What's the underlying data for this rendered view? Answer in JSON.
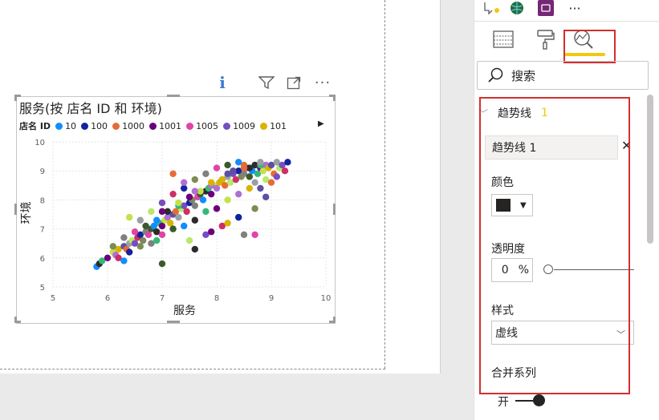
{
  "chart_data": {
    "type": "scatter",
    "title": "服务(按 店名 ID 和 环境)",
    "xlabel": "服务",
    "ylabel": "环境",
    "xlim": [
      5,
      10
    ],
    "ylim": [
      5,
      10
    ],
    "xticks": [
      "5",
      "6",
      "7",
      "8",
      "9",
      "10"
    ],
    "yticks": [
      "5",
      "6",
      "7",
      "8",
      "9",
      "10"
    ],
    "grid": true,
    "legend": {
      "title": "店名 ID",
      "placement": "top",
      "entries": [
        {
          "name": "10",
          "color": "#118dff"
        },
        {
          "name": "100",
          "color": "#12239e"
        },
        {
          "name": "1000",
          "color": "#e66c37"
        },
        {
          "name": "1001",
          "color": "#6b007b"
        },
        {
          "name": "1005",
          "color": "#e044a7"
        },
        {
          "name": "1009",
          "color": "#744ec2"
        },
        {
          "name": "101",
          "color": "#d9b300"
        }
      ]
    },
    "palette": [
      "#118dff",
      "#12239e",
      "#e66c37",
      "#6b007b",
      "#e044a7",
      "#744ec2",
      "#d9b300",
      "#2b2b2b",
      "#7d8b54",
      "#9aa0a6",
      "#c2e24d",
      "#3b5a2a",
      "#cc2f66",
      "#5e4fa2",
      "#35b779",
      "#808080",
      "#b9e86a",
      "#ae6fd6"
    ],
    "series": [
      {
        "x": [
          5.8,
          5.85,
          5.9,
          6.0,
          6.1,
          6.15,
          6.2,
          6.3,
          6.35,
          6.4,
          6.45,
          6.5,
          6.55,
          6.6,
          6.65,
          6.7,
          6.75,
          6.8,
          6.85,
          6.9,
          6.95,
          7.0,
          7.05,
          7.1,
          7.15,
          7.2,
          7.25,
          7.3,
          7.35,
          7.4,
          7.45,
          7.5,
          7.55,
          7.6,
          7.65,
          7.7,
          7.75,
          7.8,
          7.85,
          7.9,
          7.95,
          8.0,
          8.05,
          8.1,
          8.15,
          8.2,
          8.25,
          8.3,
          8.35,
          8.4,
          8.45,
          8.5,
          8.55,
          8.6,
          8.65,
          8.7,
          8.75,
          8.8,
          8.85,
          8.9,
          8.95,
          9.0,
          9.05,
          9.1,
          9.15,
          9.2,
          9.25,
          9.3,
          6.1,
          6.3,
          6.5,
          6.7,
          6.9,
          7.1,
          7.3,
          7.5,
          7.7,
          7.9,
          8.1,
          8.3,
          8.5,
          8.7,
          8.9,
          9.1,
          6.2,
          6.4,
          6.6,
          6.8,
          7.0,
          7.2,
          7.4,
          7.6,
          7.8,
          8.0,
          8.2,
          8.4,
          8.6,
          8.8,
          9.0,
          6.6,
          6.8,
          7.0,
          7.2,
          7.4,
          7.6,
          7.8,
          8.0,
          8.2,
          8.4,
          8.6,
          8.8,
          7.0,
          7.3,
          7.6,
          7.9,
          8.2,
          8.5,
          8.8,
          7.5,
          7.8,
          8.1,
          8.4,
          8.7,
          8.5,
          8.7,
          7.0,
          6.3,
          7.6,
          6.9,
          7.9,
          6.4,
          7.4,
          8.2,
          8.9,
          7.2
        ],
        "y": [
          5.7,
          5.8,
          5.9,
          6.0,
          6.2,
          6.1,
          6.3,
          6.4,
          6.3,
          6.5,
          6.6,
          6.5,
          6.7,
          6.8,
          6.6,
          6.9,
          6.8,
          7.0,
          7.1,
          6.9,
          7.2,
          7.1,
          7.3,
          7.4,
          7.2,
          7.5,
          7.6,
          7.4,
          7.7,
          7.8,
          7.6,
          7.9,
          8.0,
          7.8,
          8.1,
          8.2,
          8.0,
          8.3,
          8.4,
          8.2,
          8.5,
          8.4,
          8.6,
          8.7,
          8.5,
          8.8,
          8.6,
          8.9,
          8.7,
          9.0,
          8.8,
          8.9,
          9.1,
          8.8,
          9.0,
          9.2,
          8.9,
          9.1,
          9.0,
          9.2,
          9.1,
          9.2,
          8.9,
          9.3,
          9.1,
          9.2,
          9.0,
          9.3,
          6.4,
          6.7,
          6.9,
          7.1,
          7.3,
          7.6,
          7.8,
          8.1,
          8.3,
          8.5,
          8.7,
          9.0,
          9.2,
          8.6,
          8.7,
          8.8,
          6.0,
          6.2,
          6.4,
          6.5,
          6.8,
          7.0,
          7.1,
          7.3,
          7.6,
          7.7,
          8.0,
          8.2,
          8.4,
          8.4,
          8.6,
          7.3,
          7.6,
          7.9,
          8.2,
          8.4,
          8.7,
          8.9,
          9.1,
          9.2,
          9.3,
          9.1,
          9.2,
          7.6,
          7.9,
          8.3,
          8.6,
          8.9,
          9.1,
          9.3,
          6.6,
          6.8,
          7.1,
          7.4,
          7.7,
          6.8,
          6.8,
          5.8,
          5.9,
          6.3,
          6.6,
          6.9,
          7.4,
          8.6,
          7.2,
          8.1,
          8.9
        ]
      }
    ]
  },
  "visual_header": {
    "info_glyph": "i",
    "more_glyph": "···"
  },
  "pane": {
    "top_more": "···",
    "search_placeholder": "搜索",
    "section_title": "趋势线",
    "section_count": "1",
    "trend_item": "趋势线 1",
    "color_label": "颜色",
    "transparency_label": "透明度",
    "transparency_value": "0",
    "transparency_unit": "%",
    "style_label": "样式",
    "style_value": "虚线",
    "combine_label": "合并系列",
    "toggle_label": "开"
  },
  "colors": {
    "accent_yellow": "#f2c811",
    "highlight_red": "#d32f2f",
    "text": "#252423"
  }
}
